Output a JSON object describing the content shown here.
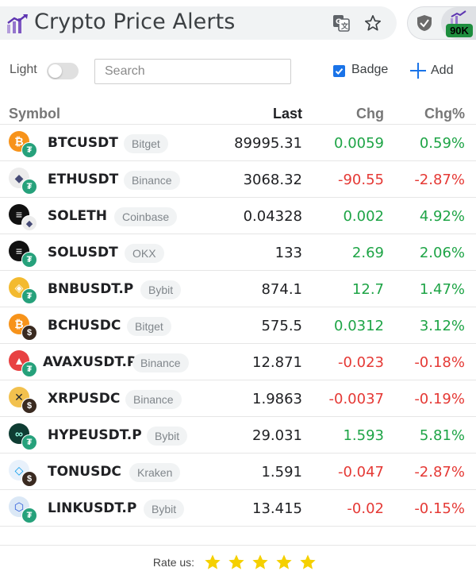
{
  "header": {
    "title": "Crypto Price Alerts",
    "extension_badge": "90K",
    "icons": [
      "app-logo-icon",
      "translate-icon",
      "bookmark-star-icon",
      "shield-extension-icon",
      "crypto-alert-extension-icon"
    ]
  },
  "controls": {
    "theme_label": "Light",
    "theme_dark_enabled": false,
    "search_placeholder": "Search",
    "search_value": "",
    "badge_label": "Badge",
    "badge_checked": true,
    "add_label": "Add"
  },
  "table": {
    "headers": {
      "symbol": "Symbol",
      "last": "Last",
      "chg": "Chg",
      "chg_pct": "Chg%"
    },
    "rows": [
      {
        "symbol": "BTCUSDT",
        "exchange": "Bitget",
        "last": "89995.31",
        "chg": "0.0059",
        "chg_pct": "0.59%",
        "direction": "up",
        "coin_icon": "bitcoin-icon",
        "coin_color": "#f7931a",
        "quote_icon": "tether-icon",
        "quote_color": "#26a17b"
      },
      {
        "symbol": "ETHUSDT",
        "exchange": "Binance",
        "last": "3068.32",
        "chg": "-90.55",
        "chg_pct": "-2.87%",
        "direction": "down",
        "coin_icon": "ethereum-icon",
        "coin_color": "#ececec",
        "quote_icon": "tether-icon",
        "quote_color": "#26a17b"
      },
      {
        "symbol": "SOLETH",
        "exchange": "Coinbase",
        "last": "0.04328",
        "chg": "0.002",
        "chg_pct": "4.92%",
        "direction": "up",
        "coin_icon": "solana-icon",
        "coin_color": "#111111",
        "quote_icon": "ethereum-icon",
        "quote_color": "#ececec"
      },
      {
        "symbol": "SOLUSDT",
        "exchange": "OKX",
        "last": "133",
        "chg": "2.69",
        "chg_pct": "2.06%",
        "direction": "up",
        "coin_icon": "solana-icon",
        "coin_color": "#111111",
        "quote_icon": "tether-icon",
        "quote_color": "#26a17b"
      },
      {
        "symbol": "BNBUSDT.P",
        "exchange": "Bybit",
        "last": "874.1",
        "chg": "12.7",
        "chg_pct": "1.47%",
        "direction": "up",
        "coin_icon": "bnb-icon",
        "coin_color": "#f3ba2f",
        "quote_icon": "tether-icon",
        "quote_color": "#26a17b"
      },
      {
        "symbol": "BCHUSDC",
        "exchange": "Bitget",
        "last": "575.5",
        "chg": "0.0312",
        "chg_pct": "3.12%",
        "direction": "up",
        "coin_icon": "bitcoin-cash-icon",
        "coin_color": "#f7931a",
        "quote_icon": "usdc-icon",
        "quote_color": "#3a2a20"
      },
      {
        "symbol": "AVAXUSDT.P",
        "exchange": "Binance",
        "last": "12.871",
        "chg": "-0.023",
        "chg_pct": "-0.18%",
        "direction": "down",
        "coin_icon": "avalanche-icon",
        "coin_color": "#e84142",
        "quote_icon": "tether-icon",
        "quote_color": "#26a17b"
      },
      {
        "symbol": "XRPUSDC",
        "exchange": "Binance",
        "last": "1.9863",
        "chg": "-0.0037",
        "chg_pct": "-0.19%",
        "direction": "down",
        "coin_icon": "xrp-icon",
        "coin_color": "#f2c14e",
        "quote_icon": "usdc-icon",
        "quote_color": "#3a2a20"
      },
      {
        "symbol": "HYPEUSDT.P",
        "exchange": "Bybit",
        "last": "29.031",
        "chg": "1.593",
        "chg_pct": "5.81%",
        "direction": "up",
        "coin_icon": "hyperliquid-icon",
        "coin_color": "#0f3d33",
        "quote_icon": "tether-icon",
        "quote_color": "#26a17b"
      },
      {
        "symbol": "TONUSDC",
        "exchange": "Kraken",
        "last": "1.591",
        "chg": "-0.047",
        "chg_pct": "-2.87%",
        "direction": "down",
        "coin_icon": "toncoin-icon",
        "coin_color": "#e8f1fb",
        "quote_icon": "usdc-icon",
        "quote_color": "#3a2a20"
      },
      {
        "symbol": "LINKUSDT.P",
        "exchange": "Bybit",
        "last": "13.415",
        "chg": "-0.02",
        "chg_pct": "-0.15%",
        "direction": "down",
        "coin_icon": "chainlink-icon",
        "coin_color": "#dbe8f6",
        "quote_icon": "tether-icon",
        "quote_color": "#26a17b"
      }
    ]
  },
  "footer": {
    "rate_label": "Rate us:",
    "stars": 5,
    "star_color": "#f5d000"
  },
  "colors": {
    "positive": "#1ea446",
    "negative": "#e53935",
    "accent": "#1a73e8"
  }
}
